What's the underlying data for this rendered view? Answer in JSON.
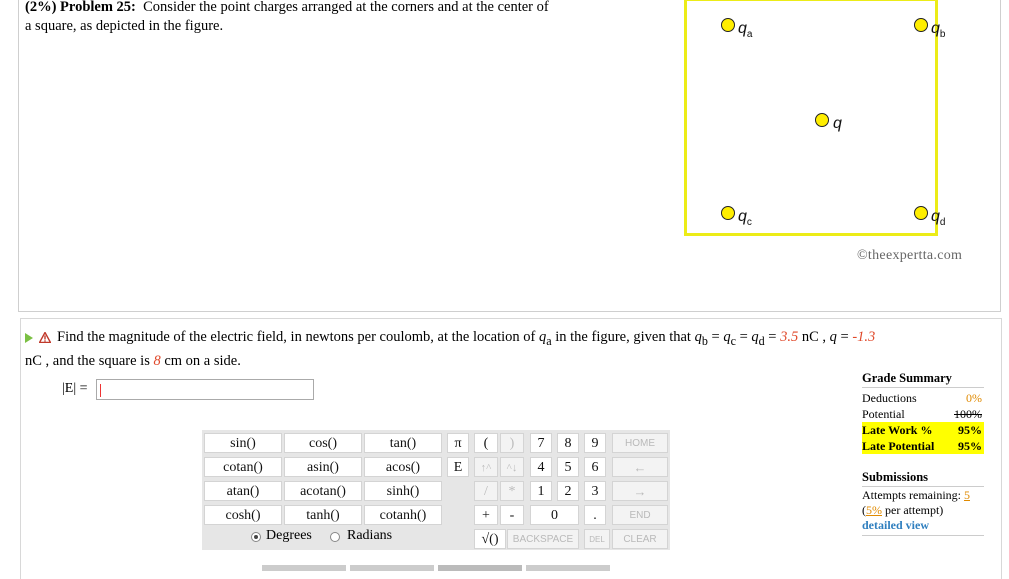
{
  "problem": {
    "heading": "(2%) Problem 25:",
    "text_line1": "Consider the point charges arranged at the corners and at the center of",
    "text_line2": "a square, as depicted in the figure."
  },
  "figure": {
    "labels": {
      "qa": "q",
      "qa_sub": "a",
      "qb": "q",
      "qb_sub": "b",
      "q": "q",
      "qc": "q",
      "qc_sub": "c",
      "qd": "q",
      "qd_sub": "d"
    },
    "border_color": "#ecec17",
    "charge_color": "#ffee00"
  },
  "copyright": "©theexpertta.com",
  "question": {
    "part1": "Find the magnitude of the electric field, in newtons per coulomb, at the location of",
    "qa": "q",
    "qa_sub": "a",
    "part2": "in the figure, given that",
    "qb": "q",
    "qb_sub": "b",
    "eq1": " = ",
    "qc": "q",
    "qc_sub": "c",
    "eq2": " = ",
    "qd": "q",
    "qd_sub": "d",
    "eq3": " = ",
    "val1": "3.5",
    "unit1": " nC , ",
    "q": "q",
    "eq4": " = ",
    "val2": "-1.3",
    "unit2": "nC",
    "part3": ", and the square is",
    "val3": "8",
    "part4": "cm on a side."
  },
  "answer": {
    "label": "|E| =",
    "value": ""
  },
  "keypad": {
    "functions": [
      [
        "sin()",
        "cos()",
        "tan()"
      ],
      [
        "cotan()",
        "asin()",
        "acos()"
      ],
      [
        "atan()",
        "acotan()",
        "sinh()"
      ],
      [
        "cosh()",
        "tanh()",
        "cotanh()"
      ]
    ],
    "symbols": [
      "π",
      "(",
      ")",
      "E",
      "↑^",
      "^↓",
      "/",
      "*",
      "+",
      "-"
    ],
    "digits": [
      [
        "7",
        "8",
        "9"
      ],
      [
        "4",
        "5",
        "6"
      ],
      [
        "1",
        "2",
        "3"
      ],
      [
        "0",
        "."
      ]
    ],
    "nav": [
      "HOME",
      "←",
      "→",
      "END"
    ],
    "sqrt": "√()",
    "backspace": "BACKSPACE",
    "del": "DEL",
    "clear": "CLEAR",
    "degrees": "Degrees",
    "radians": "Radians"
  },
  "summary": {
    "title": "Grade Summary",
    "deductions_label": "Deductions",
    "deductions_value": "0%",
    "potential_label": "Potential",
    "potential_value": "100%",
    "latework_label": "Late Work %",
    "latework_value": "95%",
    "latepotential_label": "Late Potential",
    "latepotential_value": "95%",
    "submissions_title": "Submissions",
    "attempts_label": "Attempts remaining:",
    "attempts_value": "5",
    "per_attempt_pct": "5%",
    "per_attempt_text": "per attempt)",
    "open_paren": "(",
    "detailed": "detailed view"
  }
}
